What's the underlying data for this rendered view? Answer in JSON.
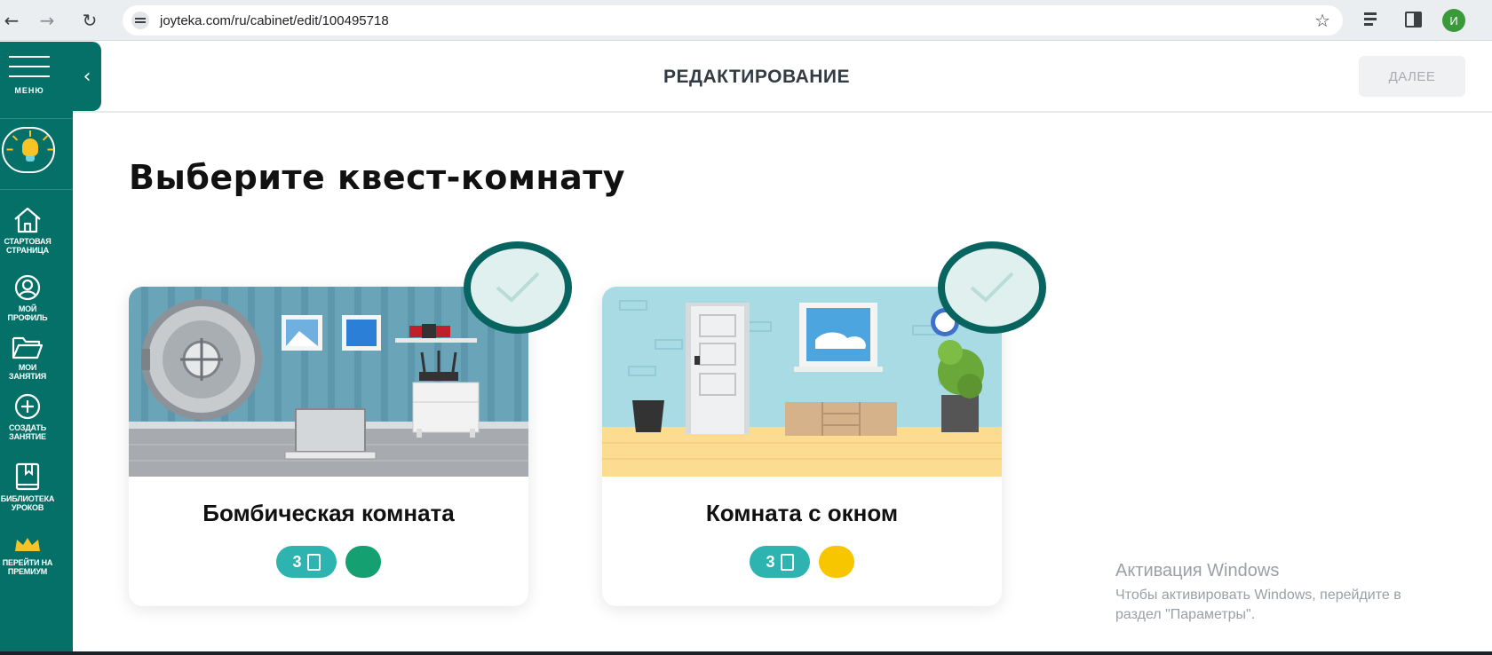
{
  "browser": {
    "url": "joyteka.com/ru/cabinet/edit/100495718",
    "profile_initial": "И"
  },
  "sidebar": {
    "menu_label": "МЕНЮ",
    "items": [
      {
        "label_line1": "СТАРТОВАЯ",
        "label_line2": "СТРАНИЦА",
        "icon": "home-icon"
      },
      {
        "label_line1": "МОЙ ПРОФИЛЬ",
        "label_line2": "",
        "icon": "user-icon"
      },
      {
        "label_line1": "МОИ ЗАНЯТИЯ",
        "label_line2": "",
        "icon": "folder-icon"
      },
      {
        "label_line1": "СОЗДАТЬ",
        "label_line2": "ЗАНЯТИЕ",
        "icon": "plus-circle-icon"
      },
      {
        "label_line1": "БИБЛИОТЕКА",
        "label_line2": "УРОКОВ",
        "icon": "book-icon"
      },
      {
        "label_line1": "ПЕРЕЙТИ НА",
        "label_line2": "ПРЕМИУМ",
        "icon": "crown-icon"
      }
    ]
  },
  "header": {
    "title": "РЕДАКТИРОВАНИЕ",
    "next_label": "ДАЛЕЕ"
  },
  "main": {
    "heading": "Выберите квест-комнату",
    "rooms": [
      {
        "title": "Бомбическая комната",
        "count": "3",
        "dot_color": "#14a070"
      },
      {
        "title": "Комната с окном",
        "count": "3",
        "dot_color": "#f7c600"
      }
    ]
  },
  "watermark": {
    "title": "Активация Windows",
    "line1": "Чтобы активировать Windows, перейдите в",
    "line2": "раздел \"Параметры\"."
  },
  "colors": {
    "sidebar": "#047068",
    "accent": "#2db3b0",
    "check_ring": "#07645f"
  }
}
